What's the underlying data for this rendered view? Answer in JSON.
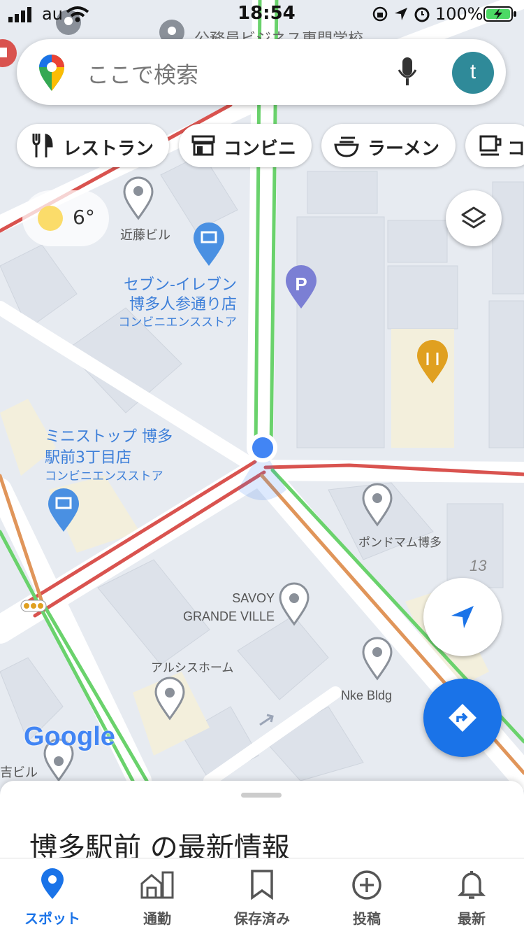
{
  "status_bar": {
    "carrier": "au",
    "time": "18:54",
    "battery": "100%"
  },
  "search": {
    "placeholder": "ここで検索",
    "avatar_letter": "t"
  },
  "chips": [
    {
      "label": "レストラン",
      "icon": "restaurant-icon"
    },
    {
      "label": "コンビニ",
      "icon": "store-icon"
    },
    {
      "label": "ラーメン",
      "icon": "ramen-icon"
    },
    {
      "label": "コ",
      "icon": "coffee-icon"
    }
  ],
  "weather": {
    "temp": "6°",
    "icon": "sun-icon"
  },
  "map": {
    "top_partial_label": "公務員ビジネス専門学校",
    "places": {
      "kondo": "近藤ビル",
      "seven_name_1": "セブン-イレブン",
      "seven_name_2": "博多人参通り店",
      "seven_type": "コンビニエンスストア",
      "ministop_name_1": "ミニストップ 博多",
      "ministop_name_2": "駅前3丁目店",
      "ministop_type": "コンビニエンスストア",
      "pondomam": "ポンドマム博多",
      "savoy_1": "SAVOY",
      "savoy_2": "GRANDE VILLE",
      "arushis": "アルシスホーム",
      "nke": "Nke Bldg",
      "yoshi": "吉ビル",
      "number_13": "13"
    },
    "google_logo": "Google",
    "colors": {
      "road": "#ffffff",
      "block": "#dfe3ea",
      "traffic_green": "#6ad26c",
      "traffic_red": "#d9534f",
      "traffic_orange": "#e0955a",
      "poi_gray": "#8a9099",
      "poi_blue": "#4a90e2",
      "poi_purple": "#7b7fd4",
      "poi_orange": "#e0a020",
      "location": "#4285f4"
    }
  },
  "sheet": {
    "title": "博多駅前 の最新情報"
  },
  "nav": [
    {
      "label": "スポット",
      "icon": "spot-pin-icon",
      "active": true
    },
    {
      "label": "通勤",
      "icon": "commute-icon",
      "active": false
    },
    {
      "label": "保存済み",
      "icon": "bookmark-icon",
      "active": false
    },
    {
      "label": "投稿",
      "icon": "add-circle-icon",
      "active": false
    },
    {
      "label": "最新",
      "icon": "bell-icon",
      "active": false
    }
  ],
  "accent": "#1a73e8"
}
